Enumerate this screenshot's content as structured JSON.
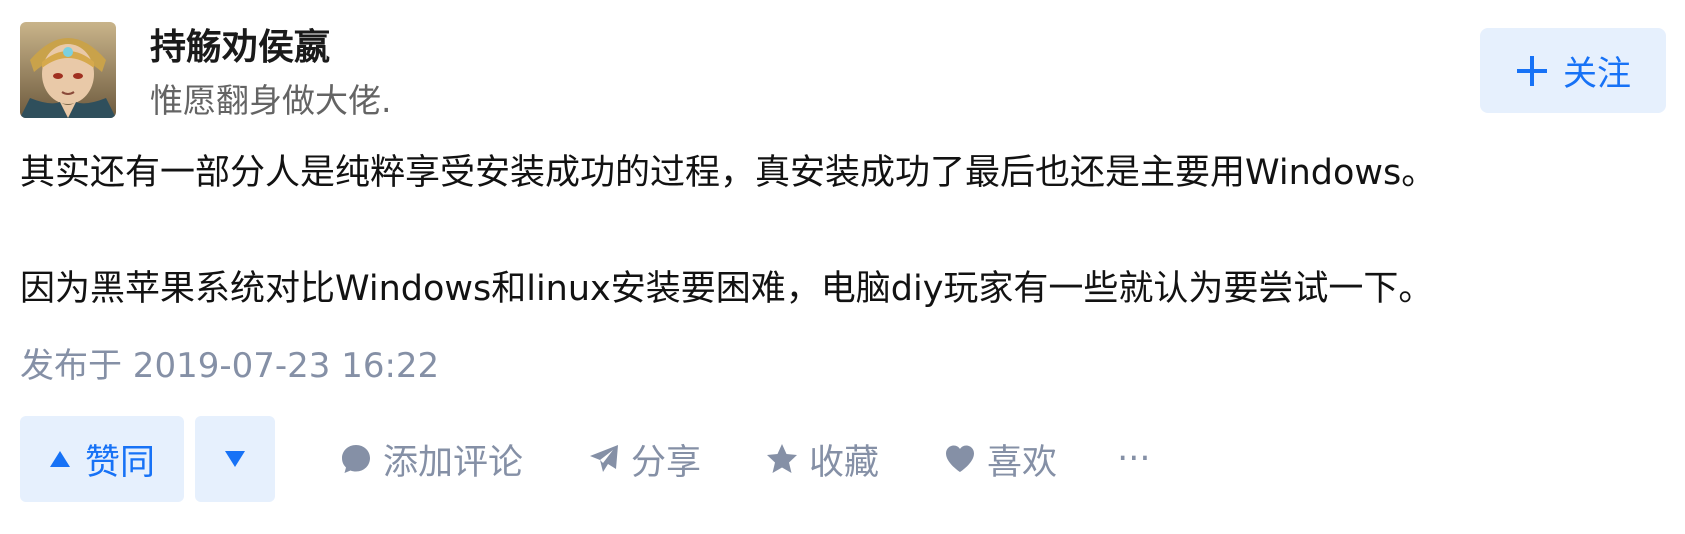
{
  "author": {
    "name": "持觞劝侯嬴",
    "bio": "惟愿翻身做大佬."
  },
  "follow_button": {
    "label": "关注"
  },
  "content": {
    "paragraphs": [
      "其实还有一部分人是纯粹享受安装成功的过程，真安装成功了最后也还是主要用Windows。",
      "因为黑苹果系统对比Windows和linux安装要困难，电脑diy玩家有一些就认为要尝试一下。"
    ]
  },
  "publish_time": "发布于 2019-07-23 16:22",
  "actions": {
    "vote_up_label": "赞同",
    "comment_label": "添加评论",
    "share_label": "分享",
    "favorite_label": "收藏",
    "like_label": "喜欢",
    "more_label": "···"
  },
  "colors": {
    "accent": "#1772f6",
    "accent_bg": "#e6f0fd",
    "muted": "#8590a6",
    "text": "#121212"
  }
}
